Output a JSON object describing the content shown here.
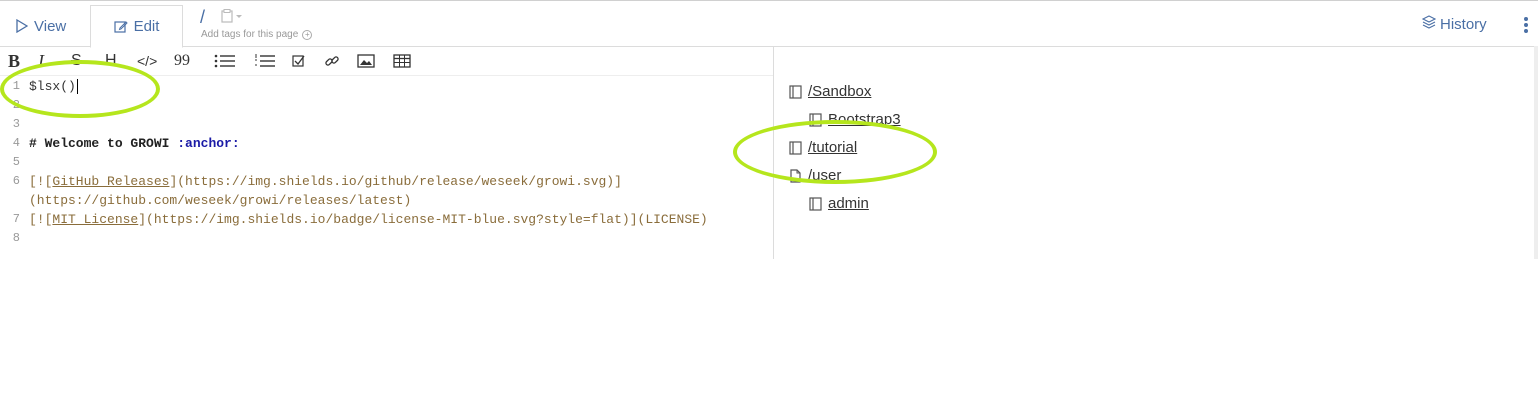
{
  "tabs": {
    "view_label": "View",
    "edit_label": "Edit"
  },
  "path": {
    "slash": "/",
    "tags_hint": "Add tags for this page"
  },
  "header": {
    "history_label": "History"
  },
  "toolbar": {
    "bold": "B",
    "italic": "I",
    "strike": "S",
    "heading": "H",
    "code": "</>",
    "quote": "99"
  },
  "editor": {
    "lines": [
      {
        "num": "1",
        "text": "$lsx()"
      },
      {
        "num": "2",
        "text": ""
      },
      {
        "num": "3",
        "text": ""
      },
      {
        "num": "4",
        "text": "# Welcome to GROWI ",
        "anchor": ":anchor:"
      },
      {
        "num": "5",
        "text": ""
      },
      {
        "num": "6",
        "link_prefix": "[![",
        "link_text": "GitHub Releases",
        "link_rest": "](https://img.shields.io/github/release/weseek/growi.svg)]"
      },
      {
        "num": "",
        "text": "(https://github.com/weseek/growi/releases/latest)"
      },
      {
        "num": "7",
        "link_prefix": "[![",
        "link_text": "MIT License",
        "link_rest": "](https://img.shields.io/badge/license-MIT-blue.svg?style=flat)](LICENSE)"
      },
      {
        "num": "8",
        "text": ""
      }
    ]
  },
  "preview": {
    "items": [
      {
        "label": "/Sandbox"
      },
      {
        "label": "Bootstrap3"
      },
      {
        "label": "/tutorial"
      },
      {
        "label": "/user"
      },
      {
        "label": "admin"
      }
    ]
  },
  "colors": {
    "accent": "#4a6fa5",
    "annotation": "#b5e61d"
  }
}
